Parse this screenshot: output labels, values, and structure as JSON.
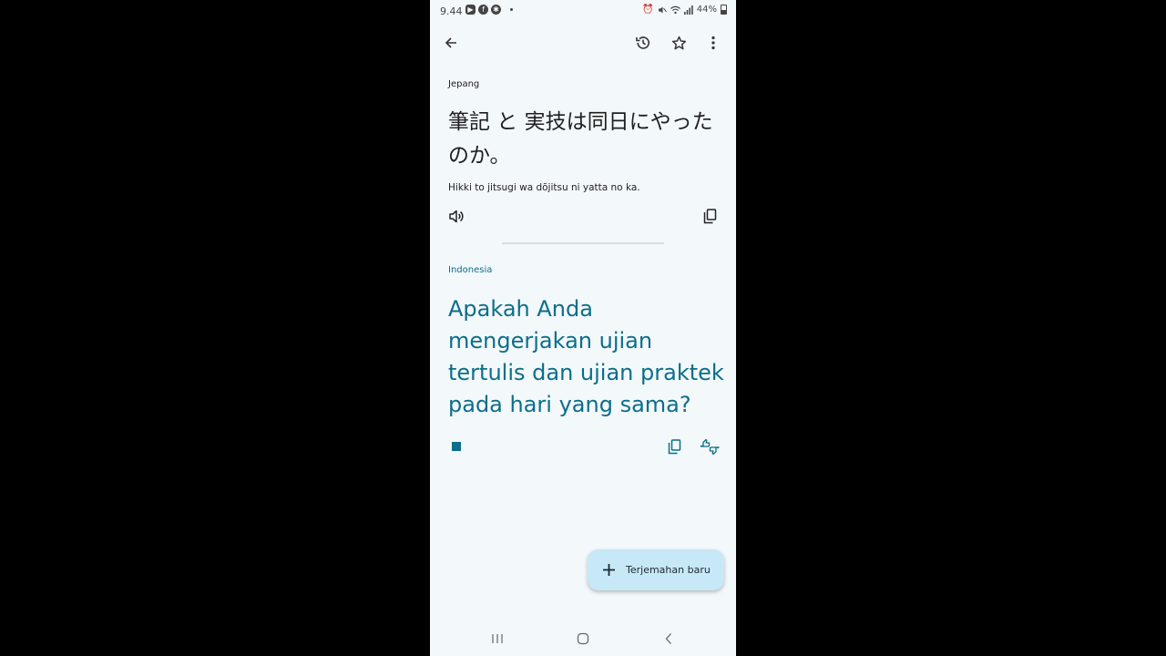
{
  "status_bar": {
    "time": "9.44",
    "battery": "44%",
    "icons": [
      "youtube-icon",
      "facebook-icon",
      "settings-icon",
      "alarm-icon",
      "mute-icon",
      "wifi-icon",
      "signal-icon",
      "battery-icon"
    ]
  },
  "app_bar": {
    "icons": [
      "back-arrow-icon",
      "history-icon",
      "star-icon",
      "more-vert-icon"
    ]
  },
  "source": {
    "language": "Jepang",
    "text": "筆記 と 実技は同日にやったのか。",
    "transliteration": "Hikki to jitsugi wa dōjitsu ni yatta no ka."
  },
  "target": {
    "language": "Indonesia",
    "text": "Apakah Anda mengerjakan ujian tertulis dan ujian praktek pada hari yang sama?"
  },
  "fab": {
    "label": "Terjemahan baru"
  },
  "colors": {
    "accent": "#0b6e8a",
    "background": "#f3f8fb",
    "fab_background": "#c7e8f6"
  }
}
